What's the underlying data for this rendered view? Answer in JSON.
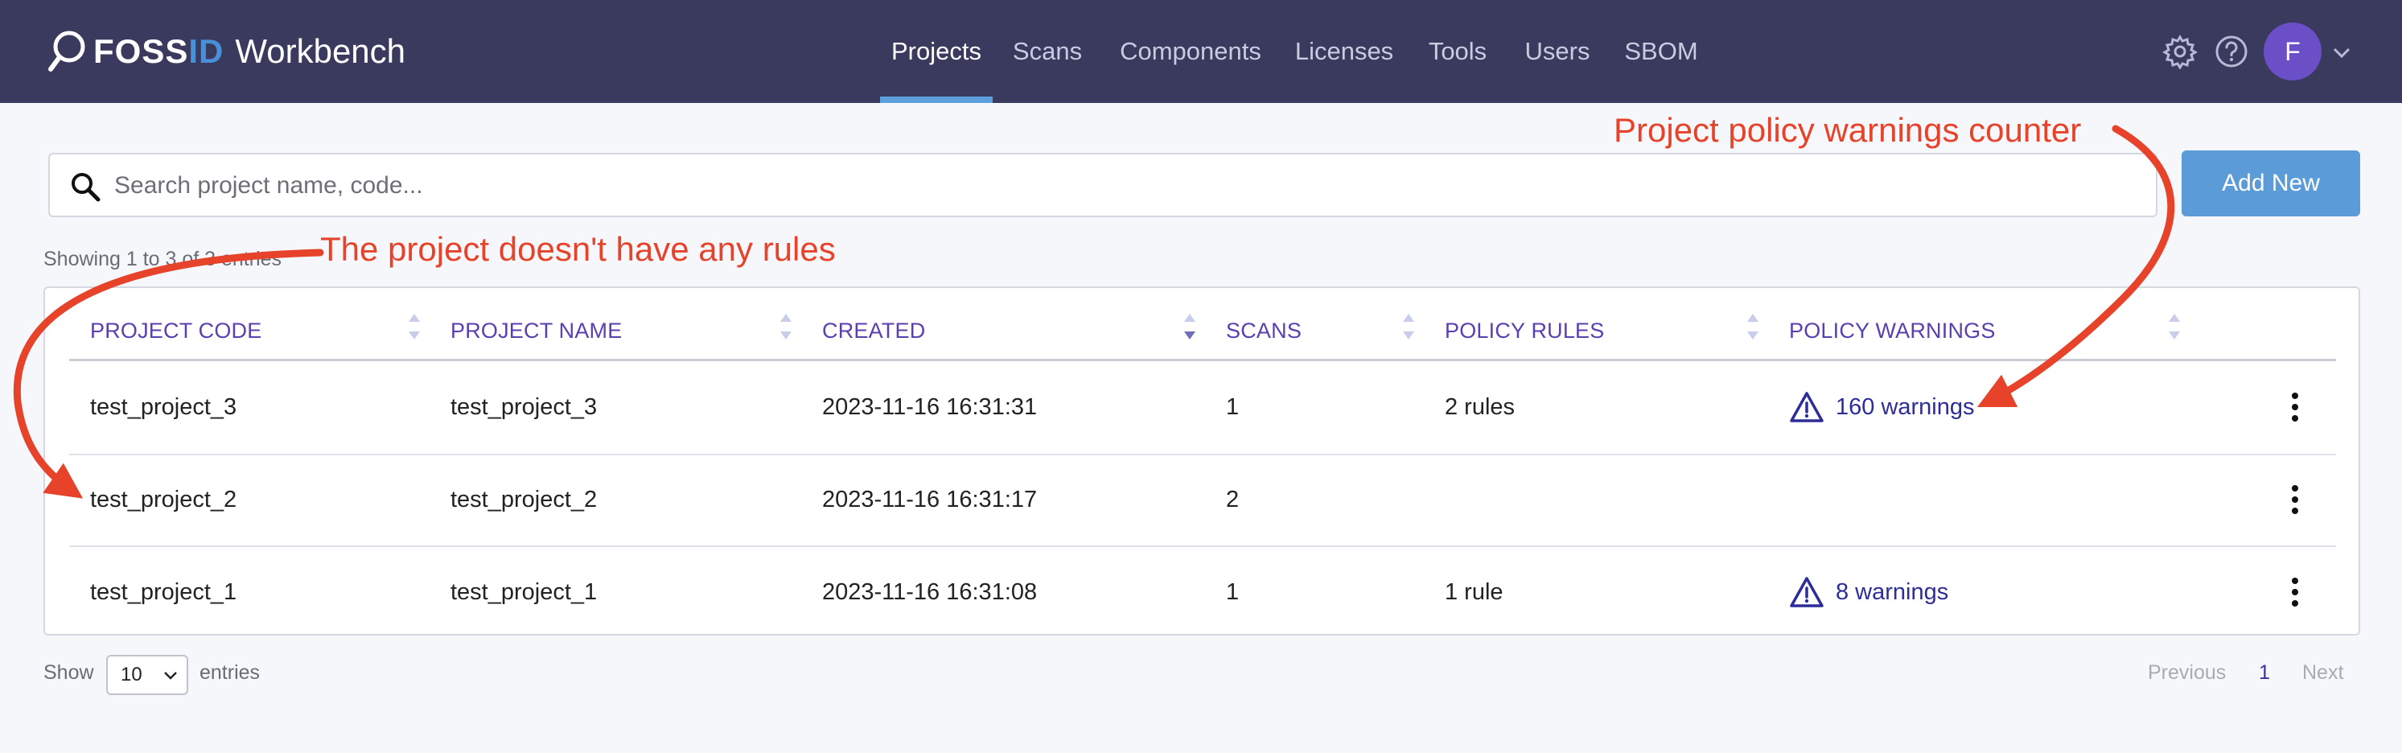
{
  "app": {
    "logo_brand": "FOSS",
    "logo_brand_accent": "ID",
    "logo_product": "Workbench"
  },
  "nav": {
    "tabs": [
      {
        "label": "Projects",
        "active": true
      },
      {
        "label": "Scans"
      },
      {
        "label": "Components"
      },
      {
        "label": "Licenses"
      },
      {
        "label": "Tools"
      },
      {
        "label": "Users"
      },
      {
        "label": "SBOM"
      }
    ]
  },
  "header_icons": [
    "gear-icon",
    "help-icon",
    "chevron-down-icon"
  ],
  "user": {
    "avatar_initial": "F"
  },
  "search": {
    "placeholder": "Search project name, code...",
    "value": ""
  },
  "actions": {
    "add_new_label": "Add New"
  },
  "table": {
    "info": "Showing 1 to 3 of 3 entries",
    "columns": [
      "PROJECT CODE",
      "PROJECT NAME",
      "CREATED",
      "SCANS",
      "POLICY RULES",
      "POLICY WARNINGS"
    ],
    "sorted_column": "CREATED",
    "rows": [
      {
        "code": "test_project_3",
        "name": "test_project_3",
        "created": "2023-11-16 16:31:31",
        "scans": "1",
        "rules": "2 rules",
        "warnings": "160 warnings"
      },
      {
        "code": "test_project_2",
        "name": "test_project_2",
        "created": "2023-11-16 16:31:17",
        "scans": "2",
        "rules": "",
        "warnings": ""
      },
      {
        "code": "test_project_1",
        "name": "test_project_1",
        "created": "2023-11-16 16:31:08",
        "scans": "1",
        "rules": "1 rule",
        "warnings": "8 warnings"
      }
    ]
  },
  "footer": {
    "show_label": "Show",
    "page_size": "10",
    "entries_label": "entries",
    "previous_label": "Previous",
    "current_page": "1",
    "next_label": "Next"
  },
  "annotations": {
    "no_rules": "The project doesn't have any rules",
    "warnings_counter": "Project policy warnings counter"
  },
  "colors": {
    "topbar": "#3a3a5f",
    "accent_blue": "#5a9bd8",
    "header_text": "#5a3fb0",
    "warning_link": "#2d2d9a",
    "annotation": "#e6432a",
    "avatar": "#6a4fc7"
  }
}
